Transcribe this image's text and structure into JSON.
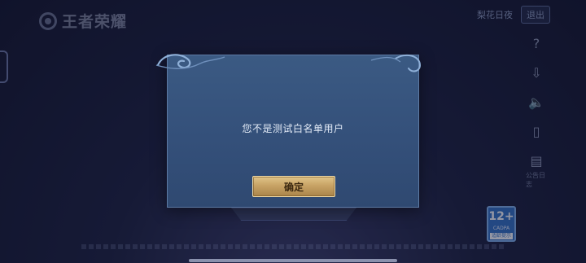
{
  "header": {
    "logo_text": "王者荣耀",
    "link_label": "梨花日夜",
    "logout_label": "退出"
  },
  "side_toolbar": {
    "items": [
      {
        "icon": "question-icon",
        "glyph": "?"
      },
      {
        "icon": "download-icon",
        "glyph": "⇩"
      },
      {
        "icon": "speaker-icon",
        "glyph": "🔈"
      },
      {
        "icon": "phone-icon",
        "glyph": "▯"
      },
      {
        "icon": "notice-icon",
        "glyph": "▤"
      }
    ],
    "last_label": "公告日志"
  },
  "age_badge": {
    "rating": "12+",
    "sub": "CADPA",
    "caption": "适龄提示"
  },
  "dialog": {
    "message": "您不是测试白名单用户",
    "confirm_label": "确定"
  },
  "colors": {
    "dialog_bg": "#34507a",
    "button_gold": "#c8a365",
    "background": "#1e2446"
  }
}
